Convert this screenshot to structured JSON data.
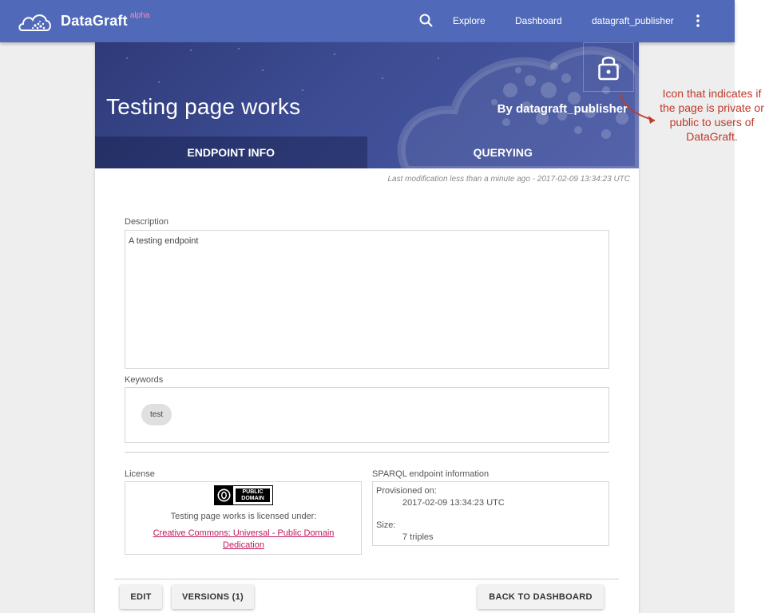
{
  "topbar": {
    "brand": "DataGraft",
    "brand_tag": "alpha",
    "links": {
      "explore": "Explore",
      "dashboard": "Dashboard",
      "user": "datagraft_publisher"
    }
  },
  "hero": {
    "title": "Testing page works",
    "owner": "By datagraft_publisher",
    "tabs": [
      "ENDPOINT INFO",
      "QUERYING"
    ],
    "active_tab": "ENDPOINT INFO"
  },
  "modified": "Last modification less than a minute ago -  2017-02-09 13:34:23 UTC",
  "description": {
    "label": "Description",
    "value": "A testing endpoint"
  },
  "keywords": {
    "label": "Keywords",
    "items": [
      "test"
    ]
  },
  "license": {
    "label": "License",
    "badge": [
      "PUBLIC",
      "DOMAIN"
    ],
    "statement": "Testing page works is licensed under:",
    "link": "Creative Commons: Universal - Public Domain Dedication"
  },
  "sparql": {
    "label": "SPARQL endpoint information",
    "provisioned_label": "Provisioned on:",
    "provisioned_value": "2017-02-09 13:34:23 UTC",
    "size_label": "Size:",
    "size_value": "7 triples"
  },
  "buttons": {
    "edit": "EDIT",
    "versions": "VERSIONS (1)",
    "back": "BACK TO DASHBOARD"
  },
  "annotation": "Icon that indicates if the page is private or public to users of DataGraft.",
  "colors": {
    "topbar": "#5069b8",
    "hero": "#3d4d94",
    "link": "#c2185b",
    "annotation": "#c0392b"
  }
}
